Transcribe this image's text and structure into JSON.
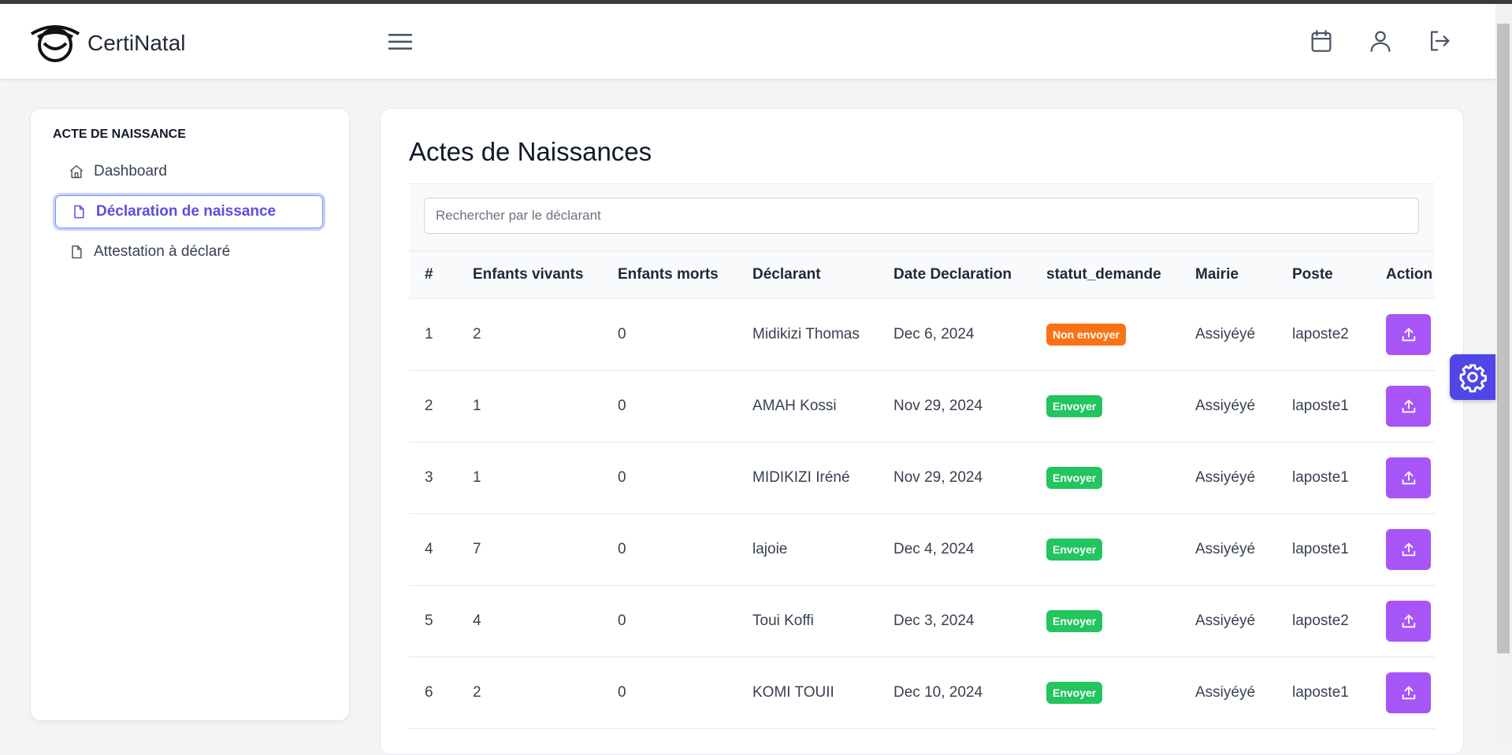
{
  "app": {
    "brand": "CertiNatal"
  },
  "sidebar": {
    "heading": "ACTE DE NAISSANCE",
    "items": [
      {
        "label": "Dashboard",
        "icon": "home-icon",
        "active": false
      },
      {
        "label": "Déclaration de naissance",
        "icon": "file-icon",
        "active": true
      },
      {
        "label": "Attestation à déclaré",
        "icon": "file-icon",
        "active": false
      }
    ]
  },
  "main": {
    "title": "Actes de Naissances",
    "search": {
      "placeholder": "Rechercher par le déclarant",
      "value": ""
    },
    "table": {
      "columns": [
        "#",
        "Enfants vivants",
        "Enfants morts",
        "Déclarant",
        "Date Declaration",
        "statut_demande",
        "Mairie",
        "Poste",
        "Action"
      ],
      "rows": [
        {
          "num": "1",
          "vivants": "2",
          "morts": "0",
          "declarant": "Midikizi Thomas",
          "date": "Dec 6, 2024",
          "statut": "Non envoyer",
          "mairie": "Assiyéyé",
          "poste": "laposte2"
        },
        {
          "num": "2",
          "vivants": "1",
          "morts": "0",
          "declarant": "AMAH Kossi",
          "date": "Nov 29, 2024",
          "statut": "Envoyer",
          "mairie": "Assiyéyé",
          "poste": "laposte1"
        },
        {
          "num": "3",
          "vivants": "1",
          "morts": "0",
          "declarant": "MIDIKIZI Iréné",
          "date": "Nov 29, 2024",
          "statut": "Envoyer",
          "mairie": "Assiyéyé",
          "poste": "laposte1"
        },
        {
          "num": "4",
          "vivants": "7",
          "morts": "0",
          "declarant": "lajoie",
          "date": "Dec 4, 2024",
          "statut": "Envoyer",
          "mairie": "Assiyéyé",
          "poste": "laposte1"
        },
        {
          "num": "5",
          "vivants": "4",
          "morts": "0",
          "declarant": "Toui Koffi",
          "date": "Dec 3, 2024",
          "statut": "Envoyer",
          "mairie": "Assiyéyé",
          "poste": "laposte2"
        },
        {
          "num": "6",
          "vivants": "2",
          "morts": "0",
          "declarant": "KOMI TOUII",
          "date": "Dec 10, 2024",
          "statut": "Envoyer",
          "mairie": "Assiyéyé",
          "poste": "laposte1"
        }
      ]
    }
  },
  "colors": {
    "accent": "#5b4ee0",
    "action_button": "#a855f7",
    "status_sent": "#22c55e",
    "status_not_sent": "#f97316",
    "settings_fab": "#4f46e5"
  },
  "icons": {
    "menu": "hamburger-icon",
    "calendar": "calendar-icon",
    "user": "user-icon",
    "logout": "logout-icon",
    "action": "upload-icon",
    "settings": "gear-icon"
  }
}
